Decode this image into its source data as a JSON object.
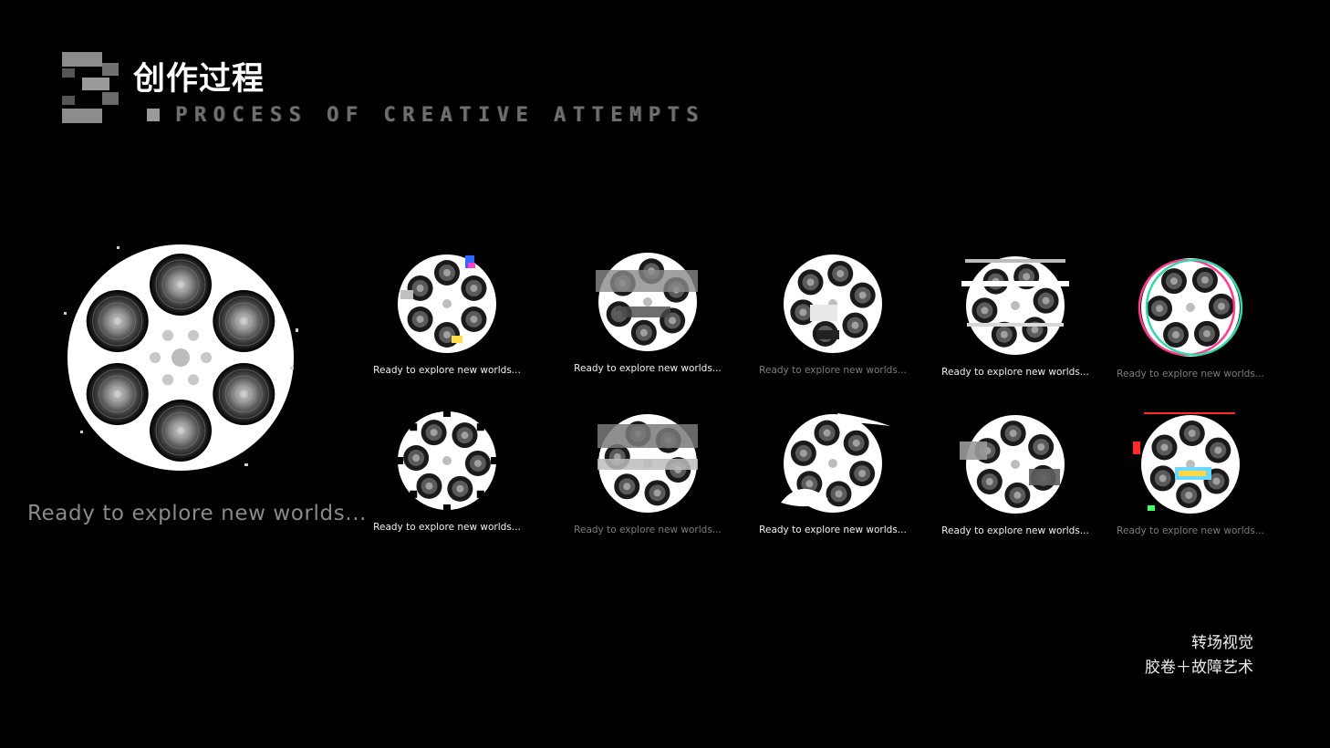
{
  "header": {
    "section_number": "3",
    "title": "创作过程",
    "subtitle": "PROCESS OF CREATIVE ATTEMPTS"
  },
  "main_reel": {
    "caption": "Ready to explore new worlds..."
  },
  "variants": [
    {
      "caption": "Ready to explore new worlds...",
      "tone": "bright",
      "glitch": "color-fringe"
    },
    {
      "caption": "Ready to explore new worlds...",
      "tone": "bright",
      "glitch": "grey-blocks"
    },
    {
      "caption": "Ready to explore new worlds...",
      "tone": "dim",
      "glitch": "pixel-chunks"
    },
    {
      "caption": "Ready to explore new worlds...",
      "tone": "bright",
      "glitch": "horizontal-slices"
    },
    {
      "caption": "Ready to explore new worlds...",
      "tone": "dim",
      "glitch": "rgb-split"
    },
    {
      "caption": "Ready to explore new worlds...",
      "tone": "bright",
      "glitch": "edge-noise"
    },
    {
      "caption": "Ready to explore new worlds...",
      "tone": "dim",
      "glitch": "grey-bands"
    },
    {
      "caption": "Ready to explore new worlds...",
      "tone": "bright",
      "glitch": "stretched-swoosh"
    },
    {
      "caption": "Ready to explore new worlds...",
      "tone": "bright",
      "glitch": "block-shift"
    },
    {
      "caption": "Ready to explore new worlds...",
      "tone": "dim",
      "glitch": "rgb-scanlines"
    }
  ],
  "footer": {
    "line1": "转场视觉",
    "line2": "胶卷＋故障艺术"
  },
  "colors": {
    "background": "#000000",
    "reel": "#ffffff",
    "caption_bright": "#f2f2f2",
    "caption_dim": "#7d7d7d",
    "subtitle": "#6f6f6f"
  }
}
